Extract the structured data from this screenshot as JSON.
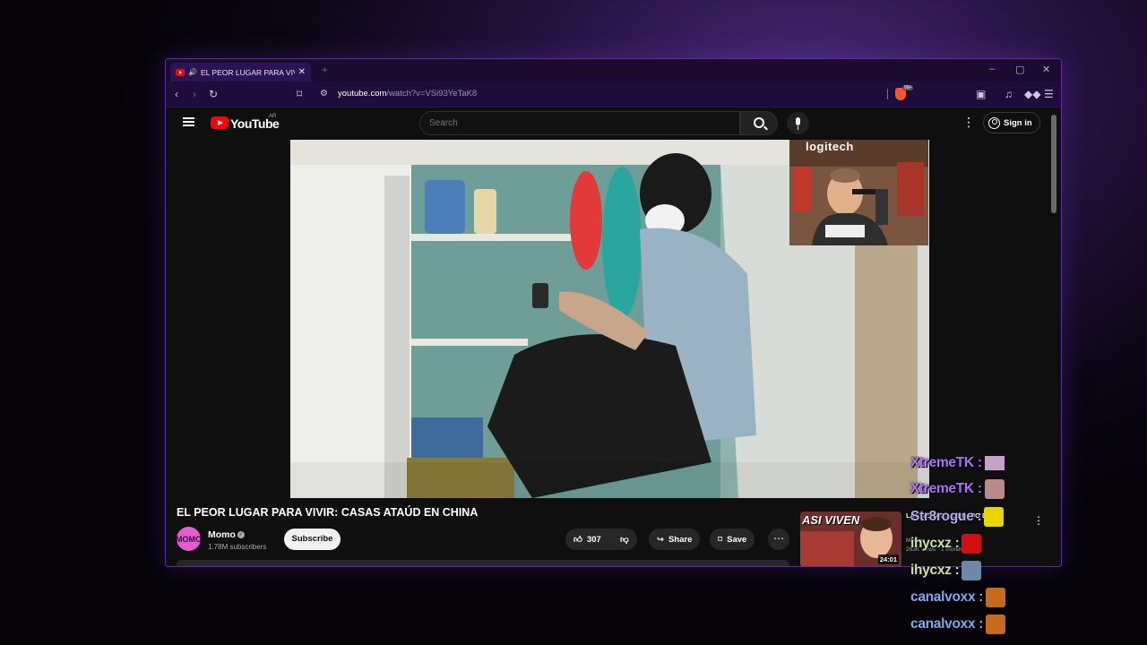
{
  "browser": {
    "tab_title": "EL PEOR LUGAR PARA VIVIR: CASAS ATAÚD EN CHINA - YouTube",
    "tab_close": "✕",
    "new_tab": "+",
    "url_host": "youtube.com",
    "url_path": "/watch?v=VSi93YeTaK8",
    "shield_badge": "99+"
  },
  "youtube": {
    "logo_text": "YouTube",
    "region": "AR",
    "search_placeholder": "Search",
    "sign_in": "Sign in",
    "video_title": "EL PEOR LUGAR PARA VIVIR: CASAS ATAÚD EN CHINA",
    "channel_name": "Momo",
    "channel_avatar_text": "MOMO",
    "subscribers": "1.78M subscribers",
    "subscribe": "Subscribe",
    "likes": "307",
    "share": "Share",
    "save": "Save",
    "webcam_brand": "logitech",
    "recommended": {
      "thumb_text": "ASI VIVEN",
      "title": "LAS VEGAS... DEBAJO DE LA TIERRA EN LAS VEGAS",
      "channel": "Momo",
      "meta": "263K views · 1 month ago",
      "duration": "24:01"
    }
  },
  "chat": [
    {
      "user": "XtremeTK :",
      "color": "#b06cff",
      "emote_color": "#c9a0c8"
    },
    {
      "user": "XtremeTK :",
      "color": "#b06cff",
      "emote_color": "#b88a8a"
    },
    {
      "user": "Str8rogue :",
      "color": "#b9a7e6",
      "emote_color": "#e8d400"
    },
    {
      "user": "ihycxz :",
      "color": "#c7e6a3",
      "emote_color": "#d01010"
    },
    {
      "user": "ihycxz :",
      "color": "#c7e6a3",
      "emote_color": "#6a8aa8"
    },
    {
      "user": "canalvoxx :",
      "color": "#7fa8f0",
      "emote_color": "#c46a1a"
    },
    {
      "user": "canalvoxx :",
      "color": "#7fa8f0",
      "emote_color": "#c46a1a"
    }
  ]
}
